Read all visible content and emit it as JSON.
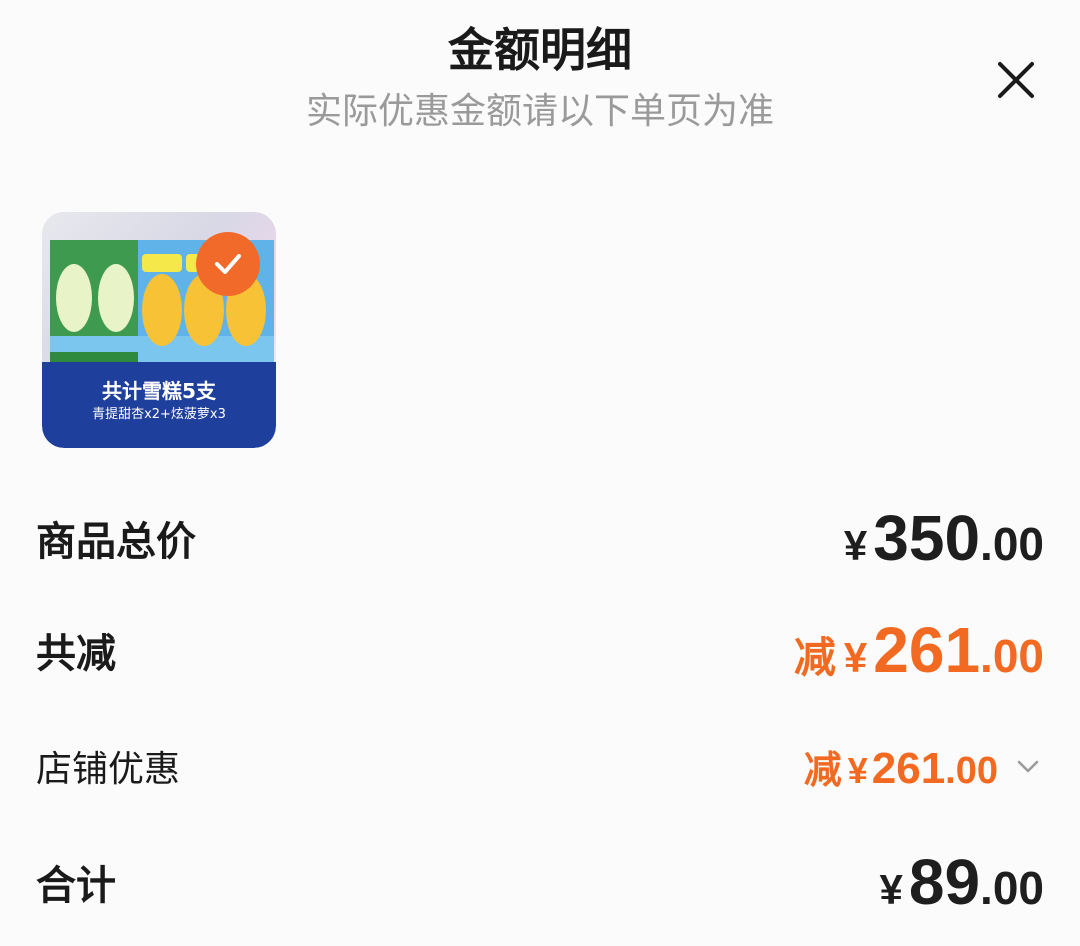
{
  "header": {
    "title": "金额明细",
    "subtitle": "实际优惠金额请以下单页为准"
  },
  "product": {
    "banner_main": "共计雪糕5支",
    "banner_sub": "青提甜杏x2+炫菠萝x3"
  },
  "rows": {
    "subtotal": {
      "label": "商品总价",
      "currency": "¥",
      "integer": "350",
      "decimal": ".00"
    },
    "total_discount": {
      "label": "共减",
      "prefix": "减",
      "currency": "¥",
      "integer": "261",
      "decimal": ".00"
    },
    "shop_discount": {
      "label": "店铺优惠",
      "prefix": "减",
      "currency": "¥",
      "integer": "261",
      "decimal": ".00"
    },
    "total": {
      "label": "合计",
      "currency": "¥",
      "integer": "89",
      "decimal": ".00"
    }
  },
  "colors": {
    "accent": "#f26a21",
    "text": "#1a1a1a",
    "subtitle": "#9a9a9a",
    "banner": "#1f3f9c"
  },
  "icons": {
    "close": "close-icon",
    "check": "check-icon",
    "chevron": "chevron-down-icon"
  }
}
